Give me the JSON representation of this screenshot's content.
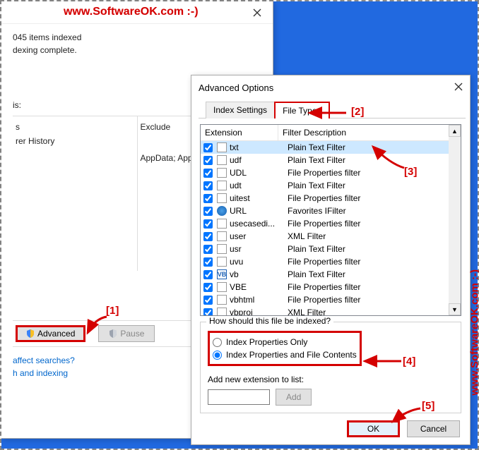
{
  "watermark_top": "www.SoftwareOK.com :-)",
  "watermark_side": "www.SoftwareOK.com :-)",
  "back_window": {
    "status1": "045 items indexed",
    "status2": "dexing complete.",
    "section_label": "is:",
    "col1_header": "s",
    "col1_item": "rer History",
    "col2_header": "Exclude",
    "col2_item": "AppData; AppData; App",
    "advanced_btn": "Advanced",
    "pause_btn": "Pause",
    "link1": "affect searches?",
    "link2": "h and indexing"
  },
  "front_window": {
    "title": "Advanced Options",
    "tab1": "Index Settings",
    "tab2": "File Types",
    "col_ext": "Extension",
    "col_desc": "Filter Description",
    "rows": [
      {
        "ext": "txt",
        "desc": "Plain Text Filter",
        "sel": true,
        "icon": ""
      },
      {
        "ext": "udf",
        "desc": "Plain Text Filter",
        "sel": false,
        "icon": ""
      },
      {
        "ext": "UDL",
        "desc": "File Properties filter",
        "sel": false,
        "icon": ""
      },
      {
        "ext": "udt",
        "desc": "Plain Text Filter",
        "sel": false,
        "icon": ""
      },
      {
        "ext": "uitest",
        "desc": "File Properties filter",
        "sel": false,
        "icon": ""
      },
      {
        "ext": "URL",
        "desc": "Favorites IFilter",
        "sel": false,
        "icon": "globe"
      },
      {
        "ext": "usecasedi...",
        "desc": "File Properties filter",
        "sel": false,
        "icon": ""
      },
      {
        "ext": "user",
        "desc": "XML Filter",
        "sel": false,
        "icon": ""
      },
      {
        "ext": "usr",
        "desc": "Plain Text Filter",
        "sel": false,
        "icon": ""
      },
      {
        "ext": "uvu",
        "desc": "File Properties filter",
        "sel": false,
        "icon": ""
      },
      {
        "ext": "vb",
        "desc": "Plain Text Filter",
        "sel": false,
        "icon": "vb",
        "iconText": "VB"
      },
      {
        "ext": "VBE",
        "desc": "File Properties filter",
        "sel": false,
        "icon": ""
      },
      {
        "ext": "vbhtml",
        "desc": "File Properties filter",
        "sel": false,
        "icon": ""
      },
      {
        "ext": "vbproj",
        "desc": "XML Filter",
        "sel": false,
        "icon": ""
      }
    ],
    "group_title": "How should this file be indexed?",
    "radio1": "Index Properties Only",
    "radio2": "Index Properties and File Contents",
    "addext_label": "Add new extension to list:",
    "add_btn": "Add",
    "ok": "OK",
    "cancel": "Cancel"
  },
  "annotations": {
    "a1": "[1]",
    "a2": "[2]",
    "a3": "[3]",
    "a4": "[4]",
    "a5": "[5]"
  }
}
